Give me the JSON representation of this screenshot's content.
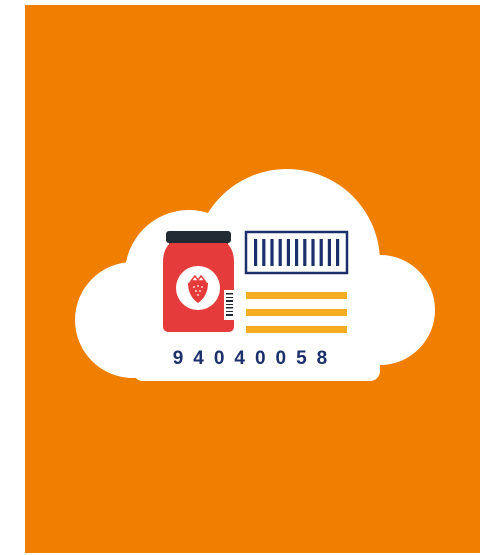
{
  "illustration": {
    "code_number": "94040058",
    "icons": [
      "cloud-icon",
      "jam-jar-icon",
      "strawberry-icon",
      "barcode-icon",
      "text-lines-icon"
    ],
    "colors": {
      "background": "#f07f00",
      "cloud": "#ffffff",
      "jar_body": "#e63b3b",
      "jar_lid": "#222a33",
      "strawberry": "#e63b3b",
      "barcode_navy": "#1b2f6b",
      "lines_yellow": "#f5ac20"
    }
  }
}
